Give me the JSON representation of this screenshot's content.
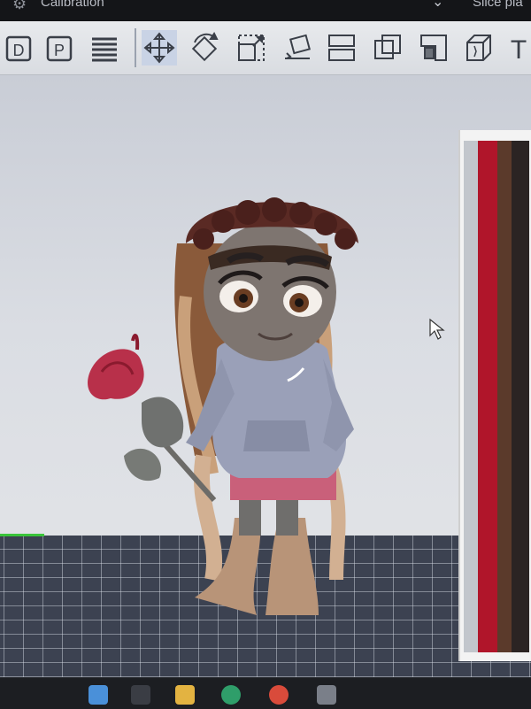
{
  "window": {
    "title": "Calibration",
    "slice_label": "Slice pla"
  },
  "toolbar": {
    "tools": [
      {
        "icon": "layer-view-icon",
        "label": "D"
      },
      {
        "icon": "preview-view-icon",
        "label": "P"
      },
      {
        "icon": "list-lines-icon"
      },
      {
        "icon": "move-arrows-icon",
        "active": true
      },
      {
        "icon": "rotate-icon"
      },
      {
        "icon": "scale-icon"
      },
      {
        "icon": "lay-flat-icon"
      },
      {
        "icon": "split-objects-icon"
      },
      {
        "icon": "boolean-overlap-icon"
      },
      {
        "icon": "support-paint-icon"
      },
      {
        "icon": "seam-cube-icon"
      },
      {
        "icon": "text-tool-icon",
        "label": "T"
      }
    ]
  },
  "colors": {
    "toolbar_bg": "#e0e2e6",
    "viewport_sky": "#d4d7de",
    "build_plate": "#3c4251",
    "plate_edge_accent": "#39c43a",
    "hoodie": "#9aa0b8",
    "shorts": "#c9607a",
    "rose": "#b8304a",
    "hair": "#5a2a24"
  },
  "taskbar": {
    "icons": [
      "start-icon",
      "search-icon",
      "file-explorer-icon",
      "edge-icon",
      "chrome-icon",
      "app-icon"
    ]
  }
}
